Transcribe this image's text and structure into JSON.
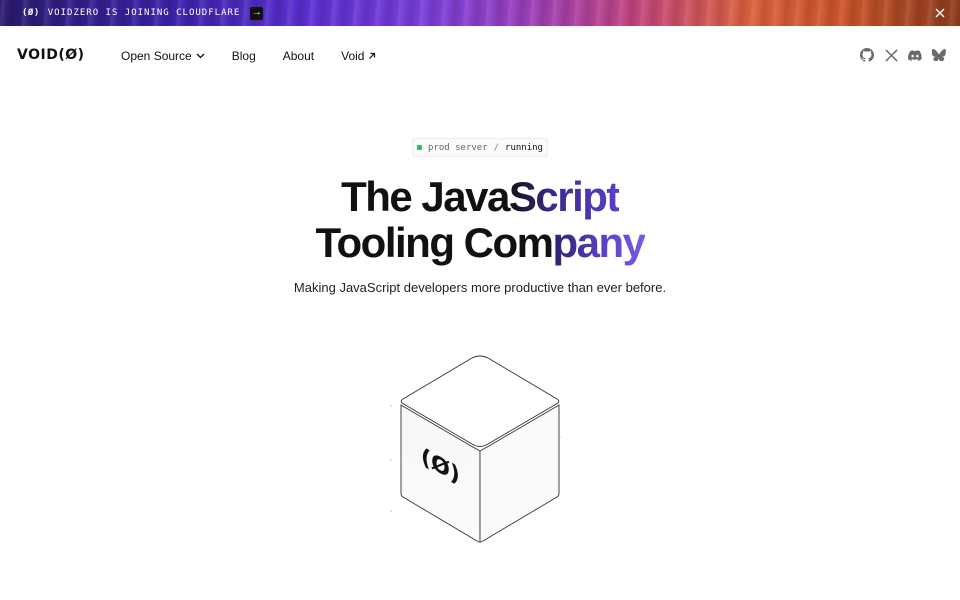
{
  "banner": {
    "logo": "(Ø)",
    "text": "VOIDZERO IS JOINING CLOUDFLARE",
    "arrow_icon": "arrow-right-icon",
    "close_icon": "close-icon"
  },
  "header": {
    "logo": "VOID(Ø)",
    "nav": [
      {
        "label": "Open Source",
        "icon": "chevron-down-icon"
      },
      {
        "label": "Blog"
      },
      {
        "label": "About"
      },
      {
        "label": "Void",
        "icon": "arrow-up-right-icon"
      }
    ],
    "social": [
      "github-icon",
      "x-icon",
      "discord-icon",
      "bluesky-icon"
    ]
  },
  "hero": {
    "status_label": "prod server",
    "status_sep": "/",
    "status_value": "running",
    "status_color": "#22c55e",
    "title_line1_plain": "The Java",
    "title_line1_accent": "Script",
    "title_line2_plain": "Tooling Com",
    "title_line2_accent": "pany",
    "subtitle": "Making JavaScript developers more productive than ever before.",
    "cube_logo": "(Ø)"
  },
  "colors": {
    "accent": "#5b3fc8",
    "banner_start": "#2a1a6e",
    "banner_end": "#c9542a"
  }
}
